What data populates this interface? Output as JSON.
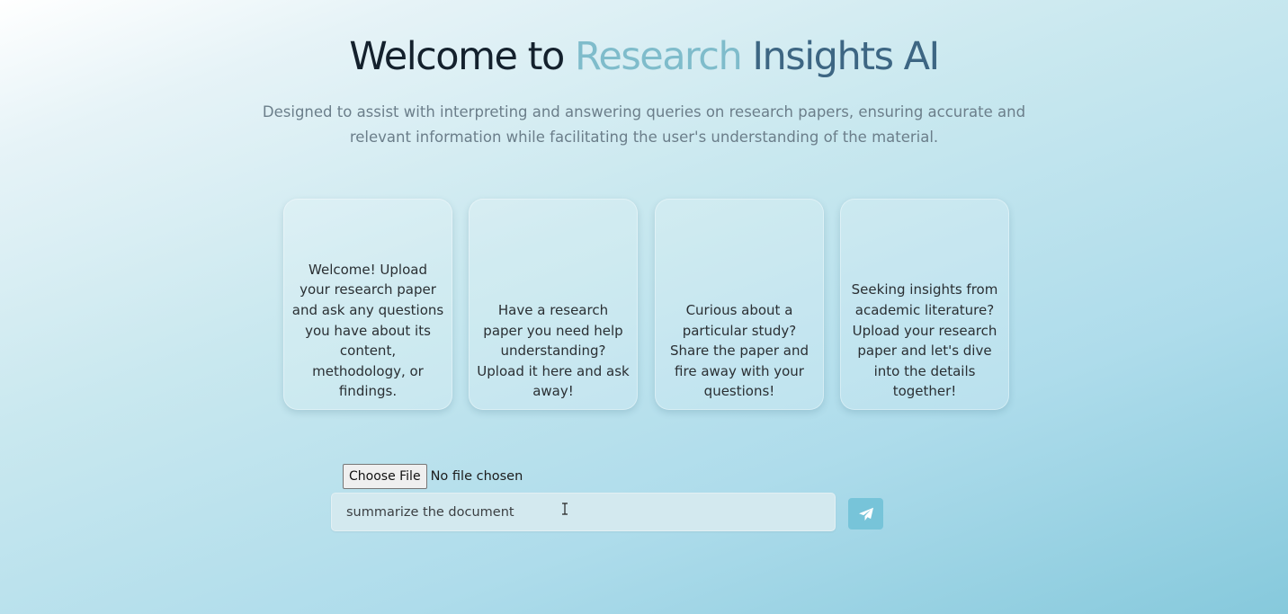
{
  "header": {
    "title_prefix": "Welcome to ",
    "title_highlight_1": "Research",
    "title_highlight_2": "Insights AI",
    "subtitle": "Designed to assist with interpreting and answering queries on research papers, ensuring accurate and relevant information while facilitating the user's understanding of the material."
  },
  "cards": [
    {
      "text": "Welcome! Upload your research paper and ask any questions you have about its content, methodology, or findings."
    },
    {
      "text": "Have a research paper you need help understanding? Upload it here and ask away!"
    },
    {
      "text": "Curious about a particular study? Share the paper and fire away with your questions!"
    },
    {
      "text": "Seeking insights from academic literature? Upload your research paper and let's dive into the details together!"
    }
  ],
  "upload": {
    "button_label": "Choose File",
    "status": "No file chosen"
  },
  "query": {
    "value": "summarize the document"
  },
  "send": {
    "icon": "paper-plane-icon"
  },
  "colors": {
    "title": "#14212d",
    "highlight_1": "#7fbccb",
    "highlight_2": "#3d6683",
    "send_button": "#77c4d9"
  }
}
